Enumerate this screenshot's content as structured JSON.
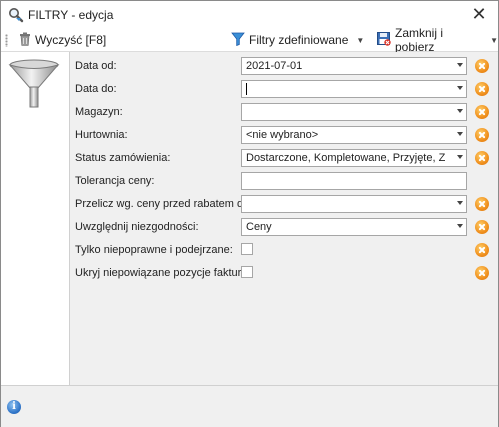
{
  "window": {
    "title": "FILTRY - edycja",
    "close_glyph": "✕"
  },
  "toolbar": {
    "clear_label": "Wyczyść [F8]",
    "defined_filters_label": "Filtry zdefiniowane",
    "close_and_fetch_label": "Zamknij i pobierz"
  },
  "fields": {
    "date_from": {
      "label": "Data od:",
      "value": "2021-07-01"
    },
    "date_to": {
      "label": "Data do:",
      "value": ""
    },
    "warehouse": {
      "label": "Magazyn:",
      "value": ""
    },
    "wholesaler": {
      "label": "Hurtownia:",
      "value": "<nie wybrano>"
    },
    "order_status": {
      "label": "Status zamówienia:",
      "value": "Dostarczone, Kompletowane, Przyjęte, Zrealiz..."
    },
    "price_tolerance": {
      "label": "Tolerancja ceny:",
      "value": ""
    },
    "recalc_price": {
      "label": "Przelicz wg. ceny przed rabatem dla:",
      "value": ""
    },
    "discrepancies": {
      "label": "Uwzględnij niezgodności:",
      "value": "Ceny"
    },
    "only_incorrect": {
      "label": "Tylko niepoprawne i podejrzane:",
      "checked": false
    },
    "hide_unlinked": {
      "label": "Ukryj niepowiązane pozycje faktur:",
      "checked": false
    }
  },
  "icons": {
    "title": "magnifier-icon",
    "clear": "trash-icon",
    "filters": "funnel-icon",
    "close_fetch": "save-close-icon",
    "panel": "funnel-icon",
    "clear_field": "clear-x-icon",
    "status": "info-icon"
  },
  "colors": {
    "clear_button": "#f0901e",
    "info": "#2f74c8",
    "filter_blue": "#3a8fd6"
  }
}
